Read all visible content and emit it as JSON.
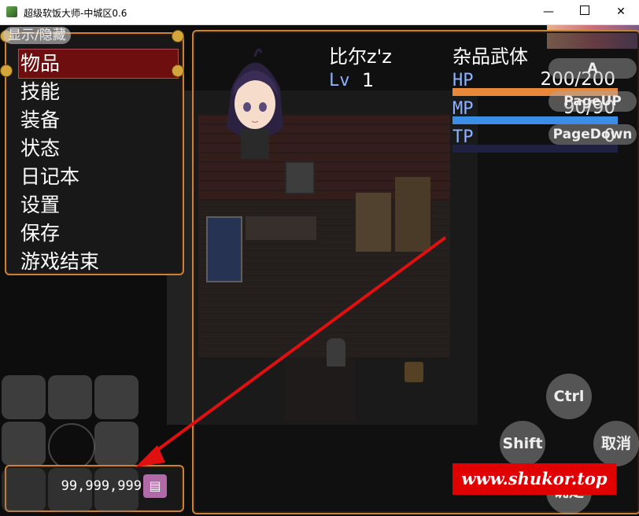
{
  "window": {
    "title": "超级软饭大师-中城区0.6",
    "minimize": "—",
    "close": "✕"
  },
  "toggle": {
    "label": "显示/隐藏"
  },
  "menu": {
    "items": [
      "物品",
      "技能",
      "装备",
      "状态",
      "日记本",
      "设置",
      "保存",
      "游戏结束"
    ],
    "selected_index": 0
  },
  "actor": {
    "name": "比尔z'z",
    "class": "杂品武体",
    "level_label": "Lv",
    "level": "1",
    "hp_label": "HP",
    "hp": "200/200",
    "hp_fraction": 1.0,
    "mp_label": "MP",
    "mp": "90/90",
    "mp_fraction": 1.0,
    "tp_label": "TP",
    "tp": "0",
    "tp_fraction": 0.0
  },
  "gold": {
    "value": "99,999,999"
  },
  "virtual_buttons": {
    "a": "A",
    "pageup": "PageUP",
    "pagedown": "PageDown",
    "ctrl": "Ctrl",
    "shift": "Shift",
    "cancel": "取消",
    "confirm": "确定"
  },
  "watermark": "www.shukor.top",
  "colors": {
    "menu_selected": "#6e0e0e",
    "frame_border": "#c8823a",
    "hp_gauge": "#e8883a",
    "mp_gauge": "#3a8ee8",
    "arrow": "#e01010",
    "watermark_bg": "#e00000"
  }
}
